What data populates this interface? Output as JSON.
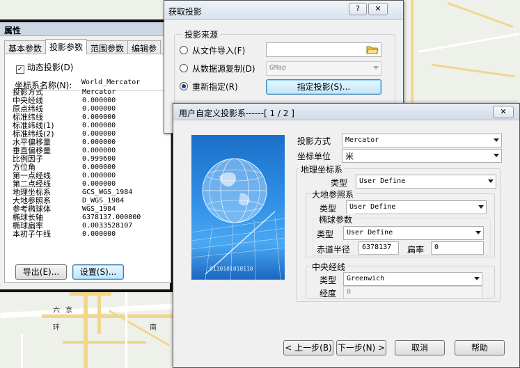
{
  "map": {
    "labels": [
      "六",
      "京",
      "环",
      "南"
    ]
  },
  "props_window": {
    "title": "属性",
    "tabs": [
      "基本参数",
      "投影参数",
      "范围参数",
      "编辑参"
    ],
    "dynamic_proj_label": "动态投影(D)",
    "dynamic_proj_checked": "✓",
    "cs_name_label": "坐标系名称(N):",
    "cs_name_value": "World_Mercator",
    "params": [
      {
        "k": "投影方式",
        "v": "Mercator"
      },
      {
        "k": "中央经线",
        "v": "0.000000"
      },
      {
        "k": "原点纬线",
        "v": "0.000000"
      },
      {
        "k": "标准纬线",
        "v": "0.000000"
      },
      {
        "k": "标准纬线(1)",
        "v": "0.000000"
      },
      {
        "k": "标准纬线(2)",
        "v": "0.000000"
      },
      {
        "k": "水平偏移量",
        "v": "0.000000"
      },
      {
        "k": "垂直偏移量",
        "v": "0.000000"
      },
      {
        "k": "比例因子",
        "v": "0.999600"
      },
      {
        "k": "方位角",
        "v": "0.000000"
      },
      {
        "k": "第一点经线",
        "v": "0.000000"
      },
      {
        "k": "第二点经线",
        "v": "0.000000"
      },
      {
        "k": "地理坐标系",
        "v": "GCS_WGS_1984"
      },
      {
        "k": "大地参照系",
        "v": "D_WGS_1984"
      },
      {
        "k": "参考椭球体",
        "v": "WGS_1984"
      },
      {
        "k": "椭球长轴",
        "v": "6378137.000000"
      },
      {
        "k": "椭球扁率",
        "v": "0.0033528107"
      },
      {
        "k": "本初子午线",
        "v": "0.000000"
      }
    ],
    "export_btn": "导出(E)...",
    "settings_btn": "设置(S)..."
  },
  "get_projection": {
    "title": "获取投影",
    "help_btn": "?",
    "close_btn": "✕",
    "group_title": "投影来源",
    "opt_file": "从文件导入(F)",
    "opt_copy": "从数据源复制(D)",
    "opt_new": "重新指定(R)",
    "copy_source": "GMap",
    "specify_btn": "指定投影(S)..."
  },
  "wizard": {
    "title": "用户自定义投影系------[ 1 / 2 ]",
    "close_btn": "✕",
    "proj_method_label": "投影方式",
    "proj_method_value": "Mercator",
    "coord_unit_label": "坐标单位",
    "coord_unit_value": "米",
    "geo_cs_label": "地理坐标系",
    "type_label": "类型",
    "geo_cs_type": "User Define",
    "datum_label": "大地参照系",
    "datum_type": "User Define",
    "ellipsoid_label": "椭球参数",
    "ellipsoid_type": "User Define",
    "eq_radius_label": "赤道半径",
    "eq_radius_value": "6378137",
    "flattening_label": "扁率",
    "flattening_value": "0",
    "central_meridian_label": "中央经线",
    "cm_type": "Greenwich",
    "longitude_label": "经度",
    "longitude_value": "0",
    "globe_text": "0110101010110",
    "prev_btn": "< 上一步(B)",
    "next_btn": "下一步(N) >",
    "cancel_btn": "取消",
    "help_btn": "帮助"
  }
}
